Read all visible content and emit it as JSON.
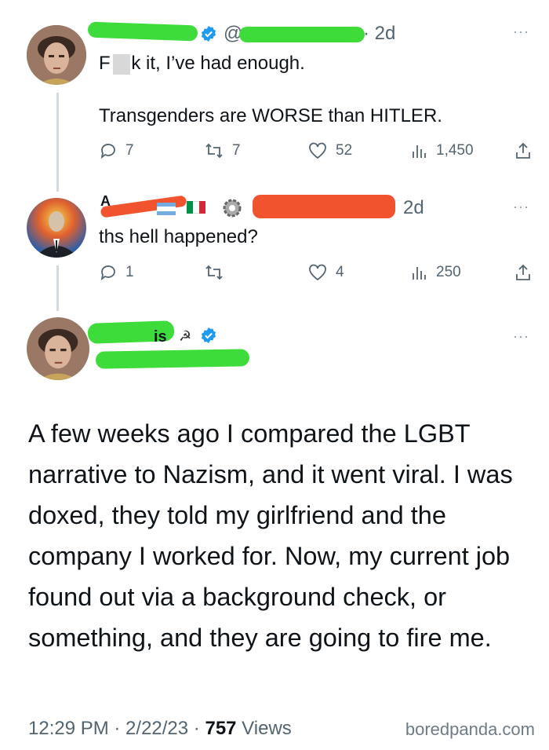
{
  "tweets": [
    {
      "handle_suffix": "@",
      "time": "· 2d",
      "text_lines": [
        "F    k it, I’ve had enough.",
        "Transgenders are WORSE than HITLER."
      ],
      "stats": {
        "replies": "7",
        "retweets": "7",
        "likes": "52",
        "views": "1,450"
      }
    },
    {
      "name_prefix": "A",
      "time": "2d",
      "text": "ths hell happened?",
      "stats": {
        "replies": "1",
        "retweets": "",
        "likes": "4",
        "views": "250"
      }
    }
  ],
  "main_tweet": {
    "name_fragment": "is",
    "body": "A few weeks ago I compared the LGBT narrative to Nazism, and it went viral. I was doxed, they told my girlfriend and the company I worked for. Now, my current job found out via a background check, or something, and they are going to fire me.",
    "footer_time": "12:29 PM · 2/22/23 · ",
    "footer_views": "757",
    "footer_views_label": " Views"
  },
  "watermark": "boredpanda.com",
  "colors": {
    "verified": "#1d9bf0",
    "redact_green": "#3ddc3a",
    "redact_red": "#f0532d",
    "muted": "#536471"
  },
  "icons": [
    "reply-icon",
    "retweet-icon",
    "like-icon",
    "views-icon",
    "share-icon",
    "verified-icon",
    "more-icon",
    "gear-icon",
    "hammer-sickle-icon"
  ]
}
